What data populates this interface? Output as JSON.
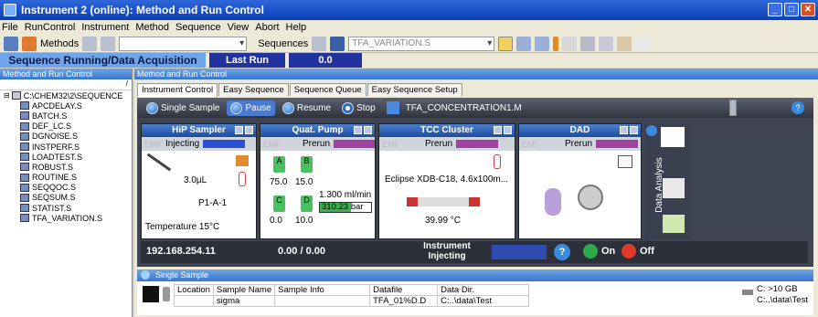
{
  "window": {
    "title": "Instrument 2 (online): Method and Run Control"
  },
  "menu": [
    "File",
    "RunControl",
    "Instrument",
    "Method",
    "Sequence",
    "View",
    "Abort",
    "Help"
  ],
  "toolbar": {
    "methods_label": "Methods",
    "method_combo": "",
    "sequences_label": "Sequences",
    "sequence_combo": "TFA_VARIATION.S"
  },
  "status": {
    "sequence_running": "Sequence Running/Data Acquisition",
    "last_run_label": "Last Run",
    "last_run_value": "0.0"
  },
  "left_panel": {
    "title": "Method and Run Control",
    "root": "C:\\CHEM32\\2\\SEQUENCE",
    "files": [
      "APCDELAY.S",
      "BATCH.S",
      "DEF_LC.S",
      "DGNOISE.S",
      "INSTPERF.S",
      "LOADTEST.S",
      "ROBUST.S",
      "ROUTINE.S",
      "SEQQOC.S",
      "SEQSUM.S",
      "STATIST.S",
      "TFA_VARIATION.S"
    ]
  },
  "right_panel": {
    "title": "Method and Run Control",
    "tabs": [
      "Instrument Control",
      "Easy Sequence",
      "Sequence Queue",
      "Easy Sequence Setup"
    ]
  },
  "control": {
    "single_sample": "Single Sample",
    "pause": "Pause",
    "resume": "Resume",
    "stop": "Stop",
    "method": "TFA_CONCENTRATION1.M"
  },
  "sampler": {
    "title": "HiP Sampler",
    "emf": "EMF",
    "status": "Injecting",
    "volume": "3.0µL",
    "position": "P1-A-1",
    "temperature": "Temperature 15°C",
    "status_color": "#2a4fd0"
  },
  "pump": {
    "title": "Quat. Pump",
    "emf": "EMF",
    "status": "Prerun",
    "a_label": "A",
    "b_label": "B",
    "c_label": "C",
    "d_label": "D",
    "a": "75.0",
    "b": "15.0",
    "c": "0.0",
    "d": "10.0",
    "flow": "1.300 ml/min",
    "pressure": "310.23 bar",
    "status_color": "#a040a0",
    "pressure_fraction": 0.6
  },
  "tcc": {
    "title": "TCC Cluster",
    "emf": "EMF",
    "status": "Prerun",
    "column": "Eclipse XDB-C18, 4.6x100m...",
    "temperature": "39.99 °C",
    "status_color": "#a040a0"
  },
  "dad": {
    "title": "DAD",
    "emf": "EMF",
    "status": "Prerun",
    "status_color": "#a040a0"
  },
  "data_analysis": "Data Analysis",
  "bottom": {
    "ip": "192.168.254.11",
    "progress": "0.00 / 0.00",
    "instrument_state": "Instrument Injecting",
    "on": "On",
    "off": "Off"
  },
  "single_sample_panel": {
    "title": "Single Sample",
    "headers": [
      "Location",
      "Sample Name",
      "Sample Info",
      "Datafile",
      "Data Dir."
    ],
    "row": [
      "",
      "sigma",
      "",
      "TFA_01%D.D",
      "C:..\\data\\Test"
    ],
    "disk": "C: >10 GB",
    "dir": "C:..\\data\\Test"
  }
}
